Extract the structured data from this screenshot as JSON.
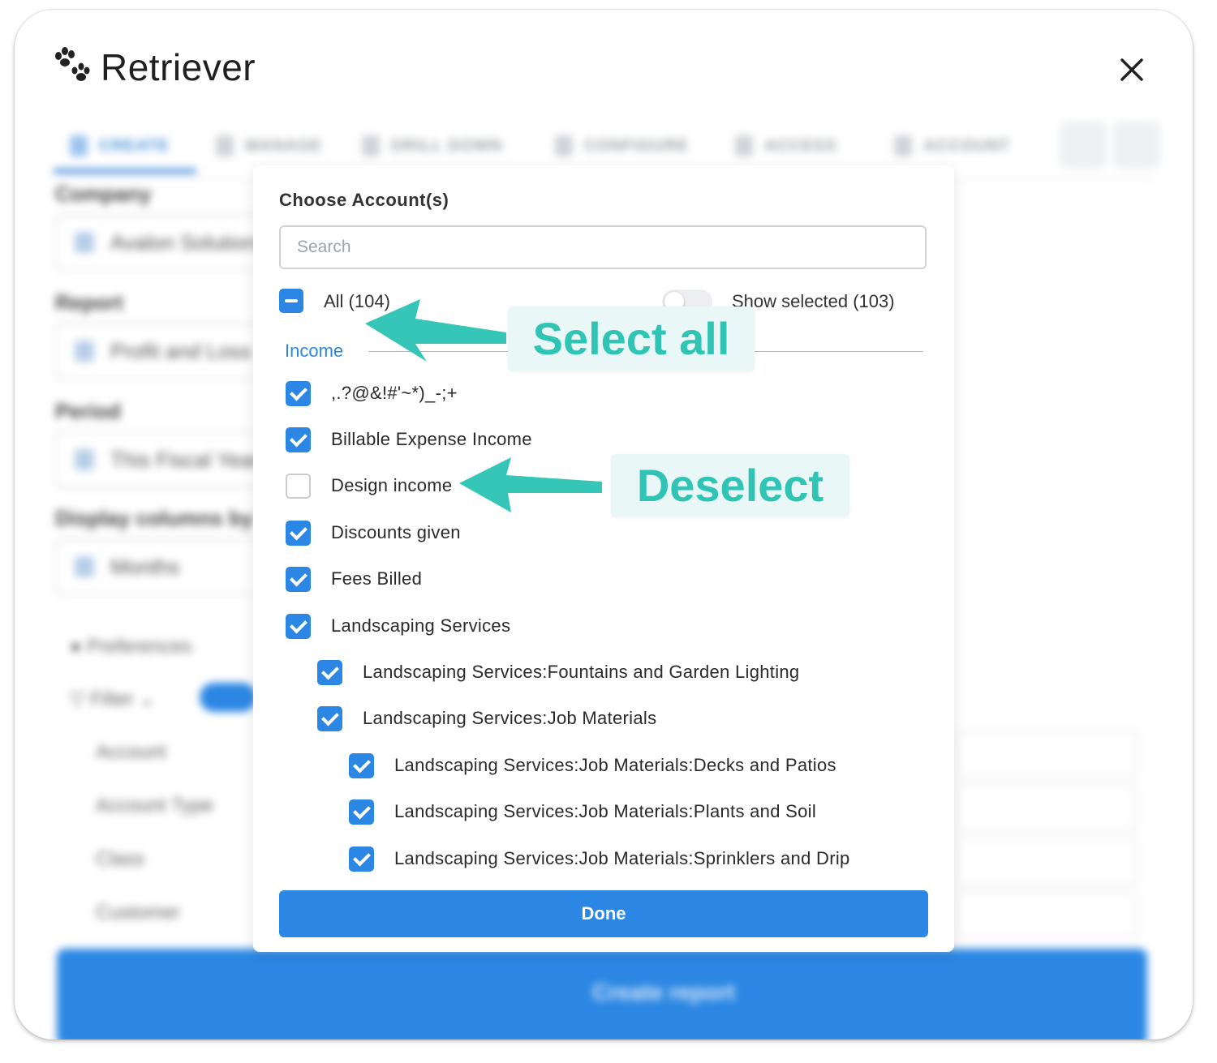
{
  "app": {
    "name": "Retriever"
  },
  "modal": {
    "title": "Choose Account(s)",
    "search_placeholder": "Search",
    "all_label": "All (104)",
    "show_selected_label": "Show selected (103)",
    "group_label": "Income",
    "items": [
      {
        "label": ",.?@&!#'~*)_-;+",
        "checked": true,
        "level": 0
      },
      {
        "label": "Billable Expense Income",
        "checked": true,
        "level": 0
      },
      {
        "label": "Design income",
        "checked": false,
        "level": 0
      },
      {
        "label": "Discounts given",
        "checked": true,
        "level": 0
      },
      {
        "label": "Fees Billed",
        "checked": true,
        "level": 0
      },
      {
        "label": "Landscaping Services",
        "checked": true,
        "level": 0
      },
      {
        "label": "Landscaping Services:Fountains and Garden Lighting",
        "checked": true,
        "level": 1
      },
      {
        "label": "Landscaping Services:Job Materials",
        "checked": true,
        "level": 1
      },
      {
        "label": "Landscaping Services:Job Materials:Decks and Patios",
        "checked": true,
        "level": 2
      },
      {
        "label": "Landscaping Services:Job Materials:Plants and Soil",
        "checked": true,
        "level": 2
      },
      {
        "label": "Landscaping Services:Job Materials:Sprinklers and Drip",
        "checked": true,
        "level": 2
      }
    ],
    "done_label": "Done"
  },
  "annotations": {
    "select_all": "Select all",
    "deselect": "Deselect"
  },
  "colors": {
    "primary": "#2b87e3",
    "annotation": "#2fc4b4",
    "annotation_bg": "#e9f8f6"
  }
}
